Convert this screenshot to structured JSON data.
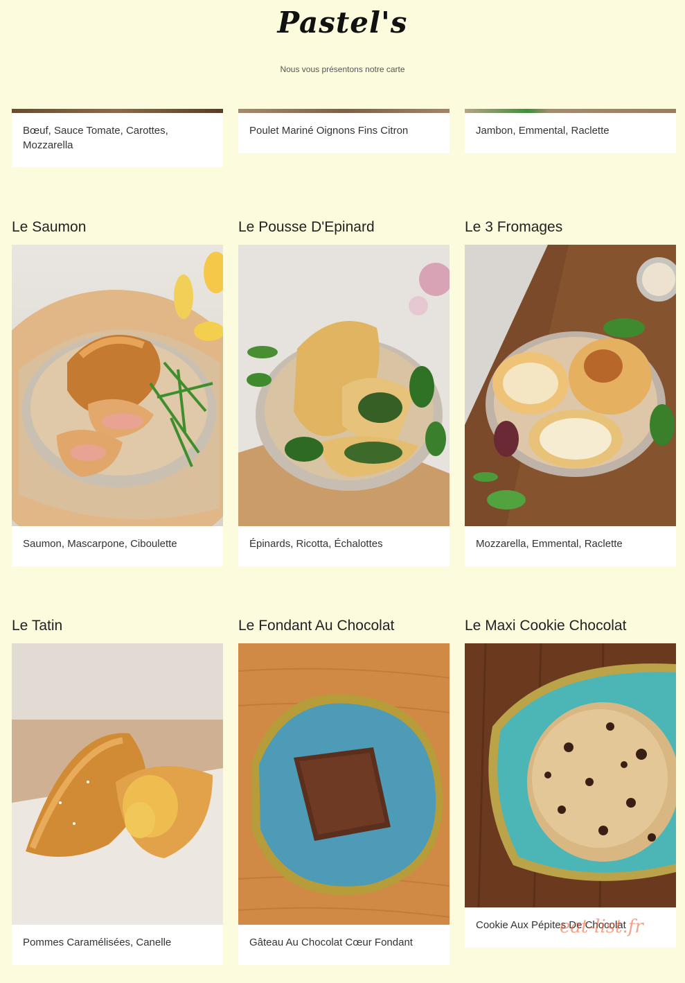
{
  "header": {
    "brand": "Pastel's",
    "tagline": "Nous vous présentons notre carte"
  },
  "top_row": [
    {
      "description": "Bœuf, Sauce Tomate, Carottes, Mozzarella"
    },
    {
      "description": "Poulet Mariné Oignons Fins Citron"
    },
    {
      "description": "Jambon, Emmental, Raclette"
    }
  ],
  "products": [
    {
      "title": "Le Saumon",
      "description": "Saumon, Mascarpone, Ciboulette",
      "image": "salmon-pastry-photo"
    },
    {
      "title": "Le Pousse D'Epinard",
      "description": "Épinards, Ricotta, Échalottes",
      "image": "spinach-pastry-photo"
    },
    {
      "title": "Le 3 Fromages",
      "description": "Mozzarella, Emmental, Raclette",
      "image": "cheese-pastry-photo"
    },
    {
      "title": "Le Tatin",
      "description": "Pommes Caramélisées, Canelle",
      "image": "apple-pastry-photo"
    },
    {
      "title": "Le Fondant Au Chocolat",
      "description": "Gâteau Au Chocolat Cœur Fondant",
      "image": "brownie-photo"
    },
    {
      "title": "Le Maxi Cookie Chocolat",
      "description": "Cookie Aux Pépites De Chocolat",
      "image": "cookie-photo"
    }
  ],
  "watermark": "eat-list.fr"
}
